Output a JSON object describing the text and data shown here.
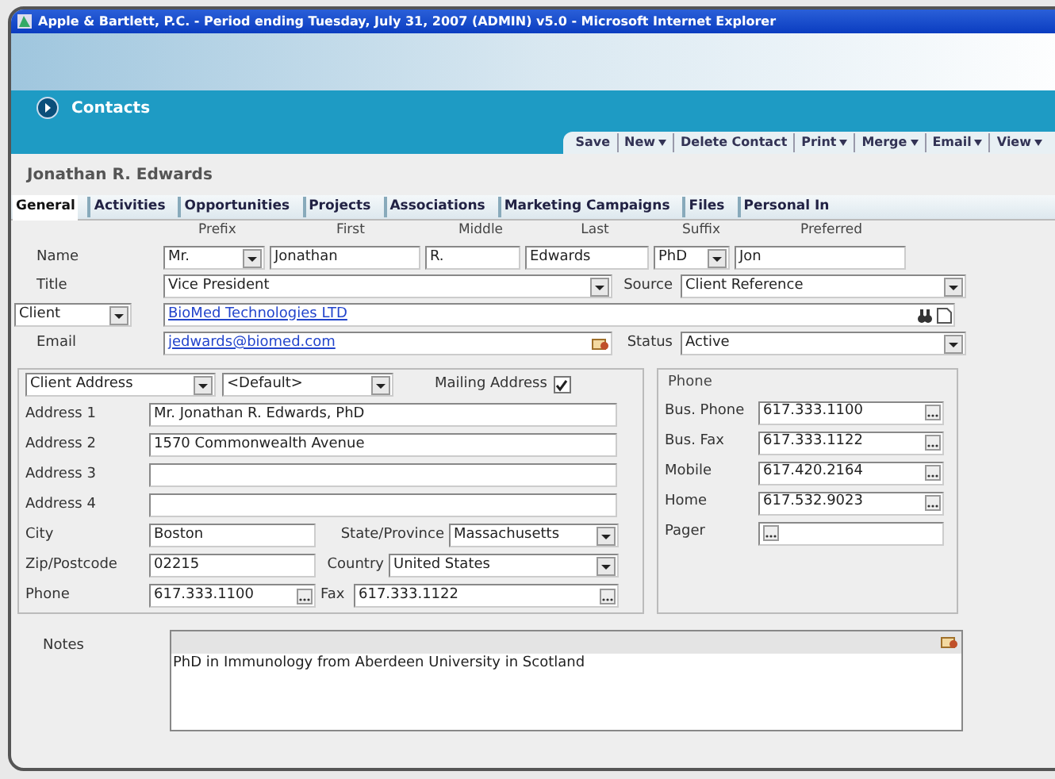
{
  "window": {
    "title": "Apple & Bartlett, P.C. - Period ending Tuesday, July 31, 2007 (ADMIN) v5.0 - Microsoft Internet Explorer"
  },
  "section": {
    "title": "Contacts"
  },
  "toolbar": [
    {
      "label": "Save",
      "menu": false
    },
    {
      "label": "New",
      "menu": true
    },
    {
      "label": "Delete Contact",
      "menu": false
    },
    {
      "label": "Print",
      "menu": true
    },
    {
      "label": "Merge",
      "menu": true
    },
    {
      "label": "Email",
      "menu": true
    },
    {
      "label": "View",
      "menu": true
    }
  ],
  "contact_name": "Jonathan R. Edwards",
  "tabs": [
    {
      "label": "General",
      "selected": true
    },
    {
      "label": "Activities",
      "selected": false
    },
    {
      "label": "Opportunities",
      "selected": false
    },
    {
      "label": "Projects",
      "selected": false
    },
    {
      "label": "Associations",
      "selected": false
    },
    {
      "label": "Marketing Campaigns",
      "selected": false
    },
    {
      "label": "Files",
      "selected": false
    },
    {
      "label": "Personal In",
      "selected": false
    }
  ],
  "name": {
    "label": "Name",
    "columns": [
      "Prefix",
      "First",
      "Middle",
      "Last",
      "Suffix",
      "Preferred"
    ],
    "prefix": "Mr.",
    "first": "Jonathan",
    "middle": "R.",
    "last": "Edwards",
    "suffix": "PhD",
    "preferred": "Jon"
  },
  "title_field": {
    "label": "Title",
    "value": "Vice President"
  },
  "source": {
    "label": "Source",
    "value": "Client Reference"
  },
  "company": {
    "type": "Client",
    "value": "BioMed Technologies LTD"
  },
  "email": {
    "label": "Email",
    "value": "jedwards@biomed.com"
  },
  "status": {
    "label": "Status",
    "value": "Active"
  },
  "address": {
    "type": "Client Address",
    "profile": "<Default>",
    "mailing_label": "Mailing Address",
    "mailing": true,
    "lines": [
      {
        "label": "Address 1",
        "value": "Mr. Jonathan R. Edwards, PhD"
      },
      {
        "label": "Address 2",
        "value": "1570 Commonwealth Avenue"
      },
      {
        "label": "Address 3"
      },
      {
        "label": "Address 4"
      }
    ],
    "city": {
      "label": "City",
      "value": "Boston"
    },
    "state": {
      "label": "State/Province",
      "value": "Massachusetts"
    },
    "zip": {
      "label": "Zip/Postcode",
      "value": "02215"
    },
    "country": {
      "label": "Country",
      "value": "United States"
    },
    "phone": {
      "label": "Phone",
      "value": "617.333.1100"
    },
    "fax": {
      "label": "Fax",
      "value": "617.333.1122"
    }
  },
  "phone_group": {
    "title": "Phone",
    "rows": [
      {
        "label": "Bus. Phone",
        "value": "617.333.1100"
      },
      {
        "label": "Bus. Fax",
        "value": "617.333.1122"
      },
      {
        "label": "Mobile",
        "value": "617.420.2164"
      },
      {
        "label": "Home",
        "value": "617.532.9023"
      },
      {
        "label": "Pager"
      }
    ]
  },
  "notes": {
    "label": "Notes",
    "value": "PhD in Immunology from Aberdeen University in Scotland"
  }
}
